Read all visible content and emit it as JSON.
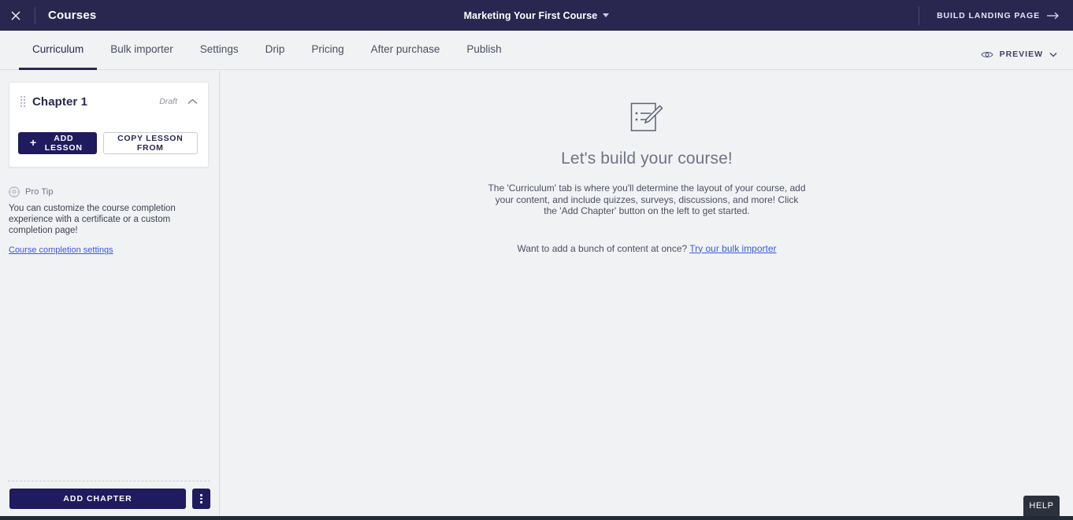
{
  "topbar": {
    "close_icon": "close-icon",
    "brand": "Courses",
    "course_name": "Marketing Your First Course",
    "course_caret_icon": "chevron-down-icon",
    "build_landing_page": "BUILD LANDING PAGE",
    "build_landing_arrow_icon": "arrow-right-icon",
    "background": "#292750"
  },
  "tabs": {
    "items": [
      {
        "label": "Curriculum",
        "active": true
      },
      {
        "label": "Bulk importer",
        "active": false
      },
      {
        "label": "Settings",
        "active": false
      },
      {
        "label": "Drip",
        "active": false
      },
      {
        "label": "Pricing",
        "active": false
      },
      {
        "label": "After purchase",
        "active": false
      },
      {
        "label": "Publish",
        "active": false
      }
    ],
    "preview_label": "PREVIEW",
    "preview_eye_icon": "eye-icon",
    "preview_caret_icon": "chevron-down-icon",
    "active_color": "#2a2850"
  },
  "sidebar": {
    "chapter": {
      "drag_handle_icon": "drag-handle-icon",
      "title": "Chapter 1",
      "status": "Draft",
      "collapse_icon": "chevron-up-icon",
      "add_lesson_label": "ADD LESSON",
      "add_lesson_plus_icon": "plus-icon",
      "copy_lesson_label": "COPY LESSON FROM"
    },
    "protip": {
      "icon": "lightbulb-icon",
      "title": "Pro Tip",
      "body": "You can customize the course completion experience with a certificate or a custom completion page!",
      "link": "Course completion settings"
    },
    "footer": {
      "add_chapter_label": "ADD CHAPTER",
      "more_icon": "kebab-menu-icon"
    },
    "primary_color": "#201a5e"
  },
  "main": {
    "empty_state": {
      "icon": "edit-document-icon",
      "title": "Let's build your course!",
      "description": "The 'Curriculum' tab is where you'll determine the layout of your course, add your content, and include quizzes, surveys, discussions, and more! Click the 'Add Chapter' button on the left to get started.",
      "sub_prefix": "Want to add a bunch of content at once? ",
      "sub_link": "Try our bulk importer",
      "link_color": "#3b5bdb"
    }
  },
  "help": {
    "label": "HELP",
    "background": "#2b323c"
  }
}
